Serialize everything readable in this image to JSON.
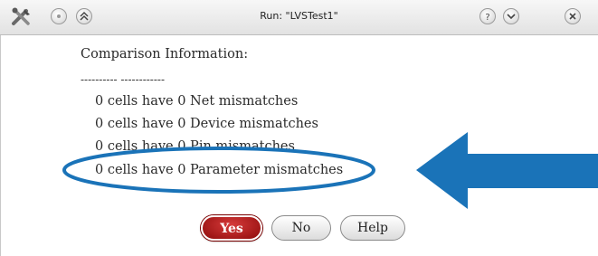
{
  "window": {
    "title": "Run: \"LVSTest1\""
  },
  "content": {
    "heading": "Comparison Information:",
    "divider": "---------- ------------",
    "lines": [
      "0 cells have 0 Net mismatches",
      "0 cells have 0 Device mismatches",
      "0 cells have 0 Pin mismatches",
      "0 cells have 0 Parameter mismatches"
    ]
  },
  "buttons": {
    "yes": "Yes",
    "no": "No",
    "help": "Help"
  },
  "annotation": {
    "ellipse_color": "#1a73b8",
    "arrow_color": "#1a73b8"
  }
}
